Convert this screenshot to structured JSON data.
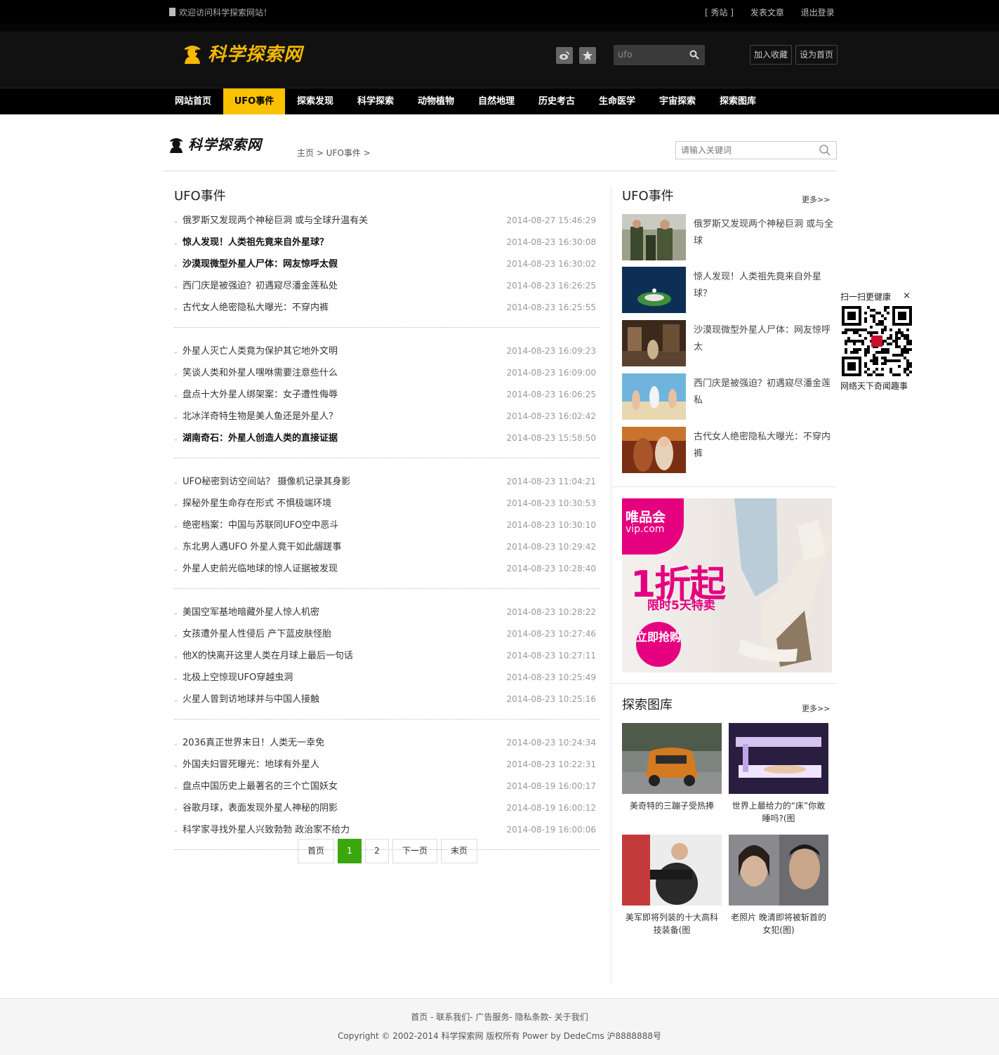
{
  "topbar": {
    "welcome": "欢迎访问科学探索网站！",
    "links": [
      "[ 秀站 ]",
      "发表文章",
      "退出登录"
    ]
  },
  "header": {
    "logo_text": "科学探索网",
    "search_value": "ufo",
    "add_favorite": "加入收藏",
    "set_home": "设为首页",
    "icons": [
      "weibo-icon",
      "star-icon",
      "search-icon"
    ]
  },
  "nav": {
    "items": [
      "网站首页",
      "UFO事件",
      "探索发现",
      "科学探索",
      "动物植物",
      "自然地理",
      "历史考古",
      "生命医学",
      "宇宙探索",
      "探索图库"
    ],
    "active": "UFO事件",
    "accent": "#f9c100"
  },
  "subheader": {
    "logo_text": "科学探索网",
    "breadcrumb": "主页 > UFO事件 >",
    "search_placeholder": "请输入关键词"
  },
  "list": {
    "title": "UFO事件",
    "groups": [
      [
        {
          "title": "俄罗斯又发现两个神秘巨洞 或与全球升温有关",
          "date": "2014-08-27 15:46:29",
          "bold": false
        },
        {
          "title": "惊人发现！人类祖先竟来自外星球？",
          "date": "2014-08-23 16:30:08",
          "bold": true
        },
        {
          "title": "沙漠现微型外星人尸体：网友惊呼太假",
          "date": "2014-08-23 16:30:02",
          "bold": true
        },
        {
          "title": "西门庆是被强迫？初遇窥尽潘金莲私处",
          "date": "2014-08-23 16:26:25",
          "bold": false
        },
        {
          "title": "古代女人绝密隐私大曝光：不穿内裤",
          "date": "2014-08-23 16:25:55",
          "bold": false
        }
      ],
      [
        {
          "title": "外星人灭亡人类竟为保护其它地外文明",
          "date": "2014-08-23 16:09:23",
          "bold": false
        },
        {
          "title": "笑谈人类和外星人嘿咻需要注意些什么",
          "date": "2014-08-23 16:09:00",
          "bold": false
        },
        {
          "title": "盘点十大外星人绑架案：女子遭性侮辱",
          "date": "2014-08-23 16:06:25",
          "bold": false
        },
        {
          "title": "北冰洋奇特生物是美人鱼还是外星人？",
          "date": "2014-08-23 16:02:42",
          "bold": false
        },
        {
          "title": "湖南奇石：外星人创造人类的直接证据",
          "date": "2014-08-23 15:58:50",
          "bold": true
        }
      ],
      [
        {
          "title": "UFO秘密到访空间站？ 摄像机记录其身影",
          "date": "2014-08-23 11:04:21",
          "bold": false
        },
        {
          "title": "探秘外星生命存在形式 不惧极端环境",
          "date": "2014-08-23 10:30:53",
          "bold": false
        },
        {
          "title": "绝密档案：中国与苏联同UFO空中恶斗",
          "date": "2014-08-23 10:30:10",
          "bold": false
        },
        {
          "title": "东北男人遇UFO 外星人竟干如此龌蹉事",
          "date": "2014-08-23 10:29:42",
          "bold": false
        },
        {
          "title": "外星人史前光临地球的惊人证据被发现",
          "date": "2014-08-23 10:28:40",
          "bold": false
        }
      ],
      [
        {
          "title": "美国空军基地暗藏外星人惊人机密",
          "date": "2014-08-23 10:28:22",
          "bold": false
        },
        {
          "title": "女孩遭外星人性侵后 产下蓝皮肤怪胎",
          "date": "2014-08-23 10:27:46",
          "bold": false
        },
        {
          "title": "他X的快离开这里人类在月球上最后一句话",
          "date": "2014-08-23 10:27:11",
          "bold": false
        },
        {
          "title": "北极上空惊现UFO穿越虫洞",
          "date": "2014-08-23 10:25:49",
          "bold": false
        },
        {
          "title": "火星人曾到访地球并与中国人接触",
          "date": "2014-08-23 10:25:16",
          "bold": false
        }
      ],
      [
        {
          "title": "2036真正世界末日！人类无一幸免",
          "date": "2014-08-23 10:24:34",
          "bold": false
        },
        {
          "title": "外国夫妇冒死曝光：地球有外星人",
          "date": "2014-08-23 10:22:31",
          "bold": false
        },
        {
          "title": "盘点中国历史上最著名的三个亡国妖女",
          "date": "2014-08-19 16:00:17",
          "bold": false
        },
        {
          "title": "谷歌月球，表面发现外星人神秘的阴影",
          "date": "2014-08-19 16:00:12",
          "bold": false
        },
        {
          "title": "科学家寻找外星人兴致勃勃 政治家不给力",
          "date": "2014-08-19 16:00:06",
          "bold": false
        }
      ]
    ]
  },
  "pager": {
    "first": "首页",
    "pages": [
      "1",
      "2"
    ],
    "current": "1",
    "next": "下一页",
    "last": "末页",
    "accent": "#3aa70e"
  },
  "side": {
    "title": "UFO事件",
    "more": "更多>>",
    "items": [
      "俄罗斯又发现两个神秘巨洞 或与全球",
      "惊人发现！人类祖先竟来自外星球？",
      "沙漠现微型外星人尸体：网友惊呼太",
      "西门庆是被强迫？初遇窥尽潘金莲私",
      "古代女人绝密隐私大曝光：不穿内裤"
    ],
    "ad": {
      "brand": "唯品会",
      "domain": "vip.com",
      "big": "1折起",
      "sub": "限时5天特卖",
      "button": "立即抢购"
    },
    "gallery_title": "探索图库",
    "gallery_more": "更多>>",
    "gallery": [
      "美奇特的三蹦子受热捧",
      "世界上最给力的“床”你敢睡吗?(图",
      "美军即将列装的十大高科技装备(图",
      "老照片 晚清即将被斩首的女犯(图)"
    ]
  },
  "qr": {
    "head": "扫一扫更健康",
    "close": "×",
    "foot": "网络天下奇闻趣事"
  },
  "footer": {
    "links": "首页 - 联系我们- 广告服务- 隐私条款- 关于我们",
    "copyright": "Copyright © 2002-2014 科学探索网 版权所有 Power by DedeCms 沪8888888号"
  }
}
